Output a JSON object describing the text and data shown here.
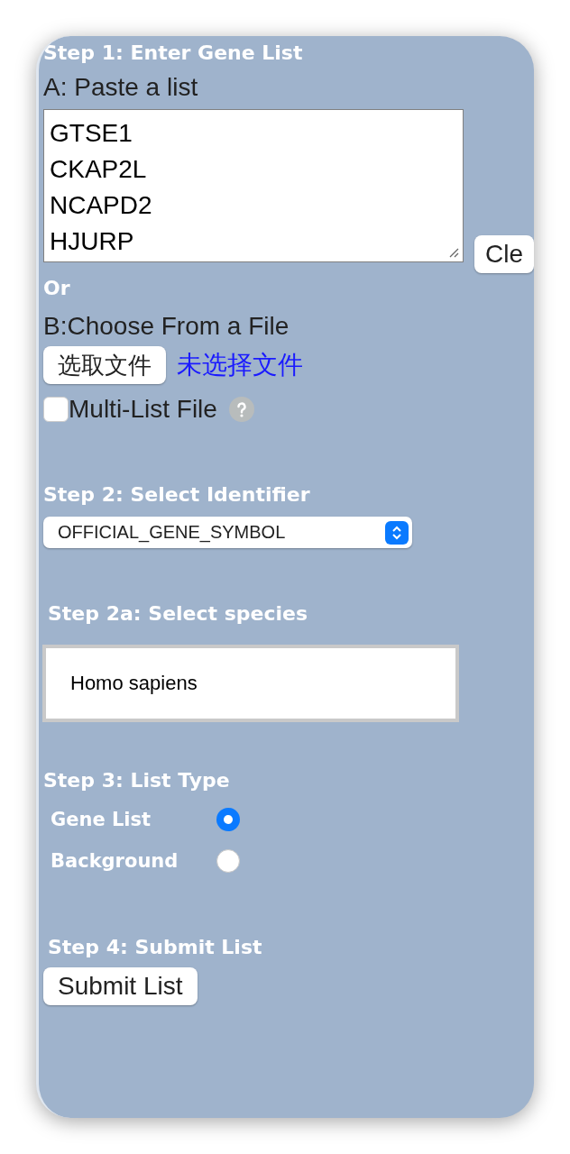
{
  "step1": {
    "heading": "Step 1: Enter Gene List",
    "paste_label": "A: Paste a list",
    "genes": [
      "GTSE1",
      "CKAP2L",
      "NCAPD2",
      "HJURP"
    ],
    "clear_button": "Cle",
    "or_label": "Or",
    "file_label": "B:Choose From a File",
    "file_button": "选取文件",
    "file_status": "未选择文件",
    "multi_list": {
      "label": "Multi-List File",
      "checked": false
    }
  },
  "step2": {
    "heading": "Step 2: Select Identifier",
    "identifier": "OFFICIAL_GENE_SYMBOL"
  },
  "step2a": {
    "heading": "Step 2a: Select species",
    "species": "Homo sapiens"
  },
  "step3": {
    "heading": "Step 3: List Type",
    "options": [
      {
        "label": "Gene List",
        "selected": true
      },
      {
        "label": "Background",
        "selected": false
      }
    ]
  },
  "step4": {
    "heading": "Step 4: Submit List",
    "submit_button": "Submit List"
  }
}
